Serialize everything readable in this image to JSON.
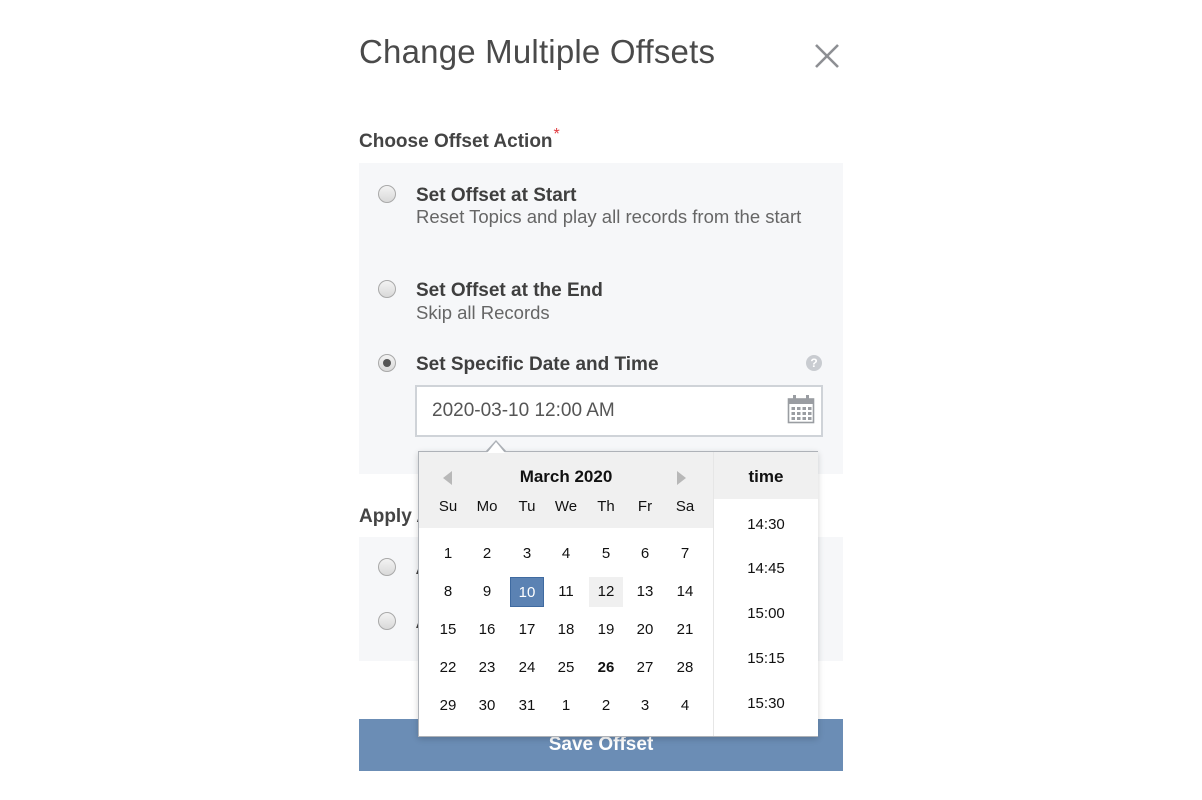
{
  "dialog": {
    "title": "Change Multiple Offsets"
  },
  "offset_action": {
    "label": "Choose Offset Action",
    "required_mark": "*",
    "options": [
      {
        "title": "Set Offset at Start",
        "description": "Reset Topics and play all records from the start",
        "checked": false
      },
      {
        "title": "Set Offset at the End",
        "description": "Skip all Records",
        "checked": false
      },
      {
        "title": "Set Specific Date and Time",
        "description": "",
        "checked": true
      }
    ],
    "help_glyph": "?",
    "date_value": "2020-03-10 12:00 AM"
  },
  "apply_section": {
    "label_partial": "Apply A",
    "option_partials": [
      "A",
      "A"
    ]
  },
  "datepicker": {
    "month_label": "March 2020",
    "weekdays": [
      "Su",
      "Mo",
      "Tu",
      "We",
      "Th",
      "Fr",
      "Sa"
    ],
    "weeks": [
      [
        "1",
        "2",
        "3",
        "4",
        "5",
        "6",
        "7"
      ],
      [
        "8",
        "9",
        "10",
        "11",
        "12",
        "13",
        "14"
      ],
      [
        "15",
        "16",
        "17",
        "18",
        "19",
        "20",
        "21"
      ],
      [
        "22",
        "23",
        "24",
        "25",
        "26",
        "27",
        "28"
      ],
      [
        "29",
        "30",
        "31",
        "1",
        "2",
        "3",
        "4"
      ]
    ],
    "selected_day": "10",
    "today_day": "26",
    "hovered_day": "12",
    "time_label": "time",
    "times": [
      "14:30",
      "14:45",
      "15:00",
      "15:15",
      "15:30"
    ]
  },
  "save_button": {
    "label": "Save Offset"
  },
  "colors": {
    "primary_button": "#6b8db5",
    "selected_day": "#5b82b3",
    "required": "#e0393e",
    "option_background": "#f6f7f9"
  }
}
